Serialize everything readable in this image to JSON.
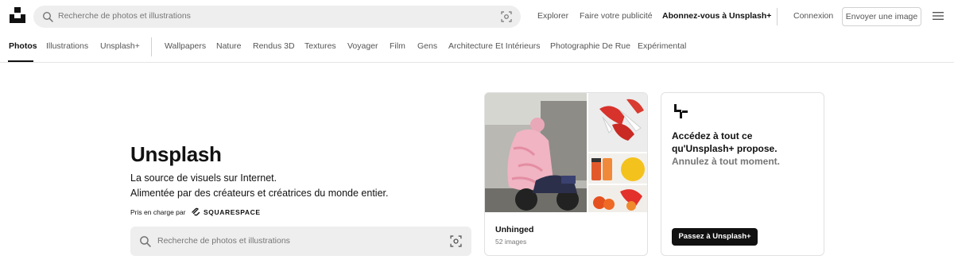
{
  "header": {
    "logo_icon": "unsplash-logo-icon",
    "search": {
      "placeholder": "Recherche de photos et illustrations"
    },
    "links": {
      "explore": "Explorer",
      "advertise": "Faire votre publicité",
      "subscribe": "Abonnez-vous à Unsplash+",
      "login": "Connexion"
    },
    "upload_label": "Envoyer une image"
  },
  "nav": {
    "primary": [
      "Photos",
      "Illustrations",
      "Unsplash+"
    ],
    "topics": [
      "Wallpapers",
      "Nature",
      "Rendus 3D",
      "Textures",
      "Voyager",
      "Film",
      "Gens",
      "Architecture Et Intérieurs",
      "Photographie De Rue",
      "Expérimental"
    ],
    "active": "Photos"
  },
  "hero": {
    "title": "Unsplash",
    "line1": "La source de visuels sur Internet.",
    "line2": "Alimentée par des créateurs et créatrices du monde entier.",
    "powered_by": "Pris en charge par",
    "sponsor": "SQUARESPACE",
    "search_placeholder": "Recherche de photos et illustrations"
  },
  "collection": {
    "title": "Unhinged",
    "count": "52 images"
  },
  "plus": {
    "line1": "Accédez à tout ce",
    "line2": "qu'Unsplash+ propose.",
    "line3": "Annulez à tout moment.",
    "button": "Passez à Unsplash+"
  },
  "colors": {
    "accent": "#111111",
    "muted": "#767676",
    "search_bg": "#eeeeee",
    "border": "#e1e1e1"
  }
}
